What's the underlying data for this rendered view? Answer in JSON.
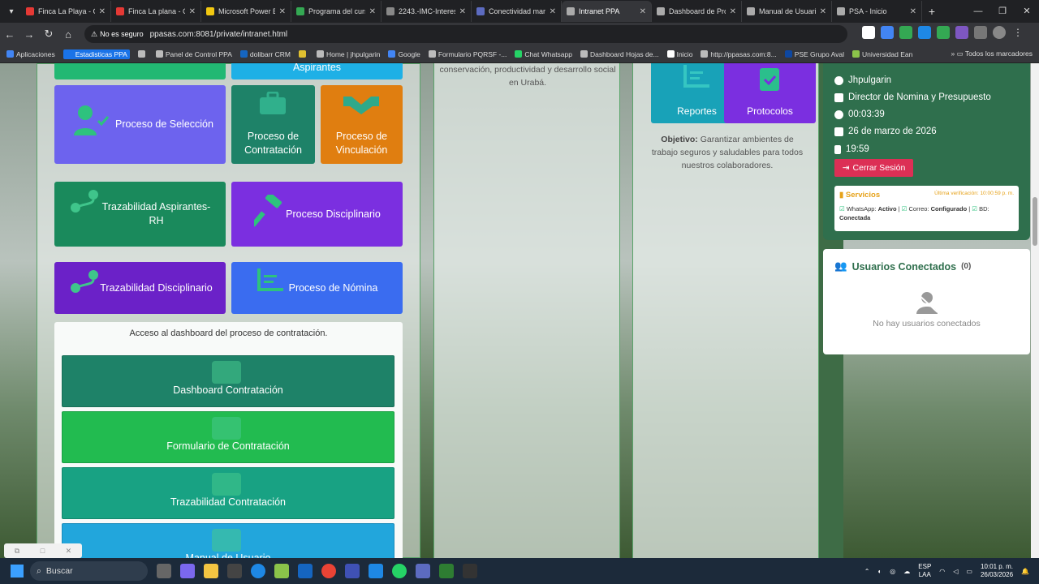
{
  "browser": {
    "tabs": [
      {
        "title": "Finca La Playa - G",
        "color": "#e53935"
      },
      {
        "title": "Finca La plana - G",
        "color": "#e53935"
      },
      {
        "title": "Microsoft Power B",
        "color": "#f2c811"
      },
      {
        "title": "Programa del curs",
        "color": "#34a853"
      },
      {
        "title": "2243.-IMC-Interes",
        "color": "#888888"
      },
      {
        "title": "Conectividad mar",
        "color": "#5c6bc0"
      },
      {
        "title": "Intranet PPA",
        "color": "#aaaaaa",
        "active": true
      },
      {
        "title": "Dashboard de Pro",
        "color": "#aaaaaa"
      },
      {
        "title": "Manual de Usuari",
        "color": "#aaaaaa"
      },
      {
        "title": "PSA - Inicio",
        "color": "#aaaaaa"
      }
    ],
    "security": "No es seguro",
    "url": "ppasas.com:8081/private/intranet.html",
    "bookmarks": [
      {
        "label": "Aplicaciones",
        "color": "#4285f4"
      },
      {
        "label": "Estadisticas PPA",
        "color": "#1a73e8",
        "highlight": true
      },
      {
        "label": "",
        "color": "#bbbbbb"
      },
      {
        "label": "Panel de Control PPA",
        "color": "#bbbbbb"
      },
      {
        "label": "dolibarr CRM",
        "color": "#1565c0"
      },
      {
        "label": "",
        "color": "#e0c030"
      },
      {
        "label": "Home | jhpulgarin",
        "color": "#bbbbbb"
      },
      {
        "label": "Google",
        "color": "#4285f4"
      },
      {
        "label": "Formulario PQRSF -...",
        "color": "#bbbbbb"
      },
      {
        "label": "Chat Whatsapp",
        "color": "#25d366"
      },
      {
        "label": "Dashboard Hojas de...",
        "color": "#bbbbbb"
      },
      {
        "label": "Inicio",
        "color": "#ffffff"
      },
      {
        "label": "http://ppasas.com:8...",
        "color": "#bbbbbb"
      },
      {
        "label": "PSE Grupo Aval",
        "color": "#0d47a1"
      },
      {
        "label": "Universidad Ean",
        "color": "#8bc34a"
      }
    ],
    "bookmarks_all": "Todos los marcadores"
  },
  "tiles": {
    "aspirantes": "Aspirantes",
    "seleccion": "Proceso de Selección",
    "contratacion": "Proceso de Contratación",
    "vinculacion": "Proceso de Vinculación",
    "trazabilidad_aspirantes": "Trazabilidad Aspirantes-RH",
    "disciplinario": "Proceso Disciplinario",
    "trazabilidad_disciplinario": "Trazabilidad Disciplinario",
    "nomina": "Proceso de Nómina"
  },
  "panel": {
    "text": "Acceso al dashboard del proceso de contratación.",
    "buttons": [
      {
        "label": "Dashboard Contratación",
        "color": "#1e8268",
        "icon": "briefcase-icon"
      },
      {
        "label": "Formulario de Contratación",
        "color": "#22bb50",
        "icon": "form-edit-icon"
      },
      {
        "label": "Trazabilidad Contratación",
        "color": "#18a283",
        "icon": "route-icon"
      },
      {
        "label": "Manual de Usuario",
        "color": "#22a6dc",
        "icon": "sitemap-icon"
      }
    ]
  },
  "col2": {
    "text": "conservación, productividad y desarrollo social en Urabá."
  },
  "col3": {
    "reportes": "Reportes",
    "protocolos": "Protocolos",
    "objetivo_label": "Objetivo:",
    "objetivo_text": "Garantizar ambientes de trabajo seguros y saludables para todos nuestros colaboradores."
  },
  "user": {
    "name": "Jhpulgarin",
    "role": "Director de Nomina y Presupuesto",
    "session": "00:03:39",
    "date": "26 de marzo de 2026",
    "time": "19:59",
    "logout": "Cerrar Sesión",
    "services_title": "Servicios",
    "verification": "Última verificación: 10:00:59 p. m.",
    "whatsapp_label": "WhatsApp:",
    "whatsapp_status": "Activo",
    "correo_label": "Correo:",
    "correo_status": "Configurado",
    "bd_label": "BD:",
    "bd_status": "Conectada"
  },
  "connected": {
    "title": "Usuarios Conectados",
    "count": "(0)",
    "empty": "No hay usuarios conectados"
  },
  "taskbar": {
    "search_placeholder": "Buscar",
    "lang1": "ESP",
    "lang2": "LAA",
    "clock_time": "10:01 p. m.",
    "clock_date": "26/03/2026"
  },
  "colors": {
    "green": "#2f6f4d",
    "teal": "#1e8268",
    "purple": "#7b2fe0",
    "indigo": "#6366f1",
    "orange": "#e07e10",
    "blue": "#3a6cf0",
    "red": "#dc2f55"
  }
}
